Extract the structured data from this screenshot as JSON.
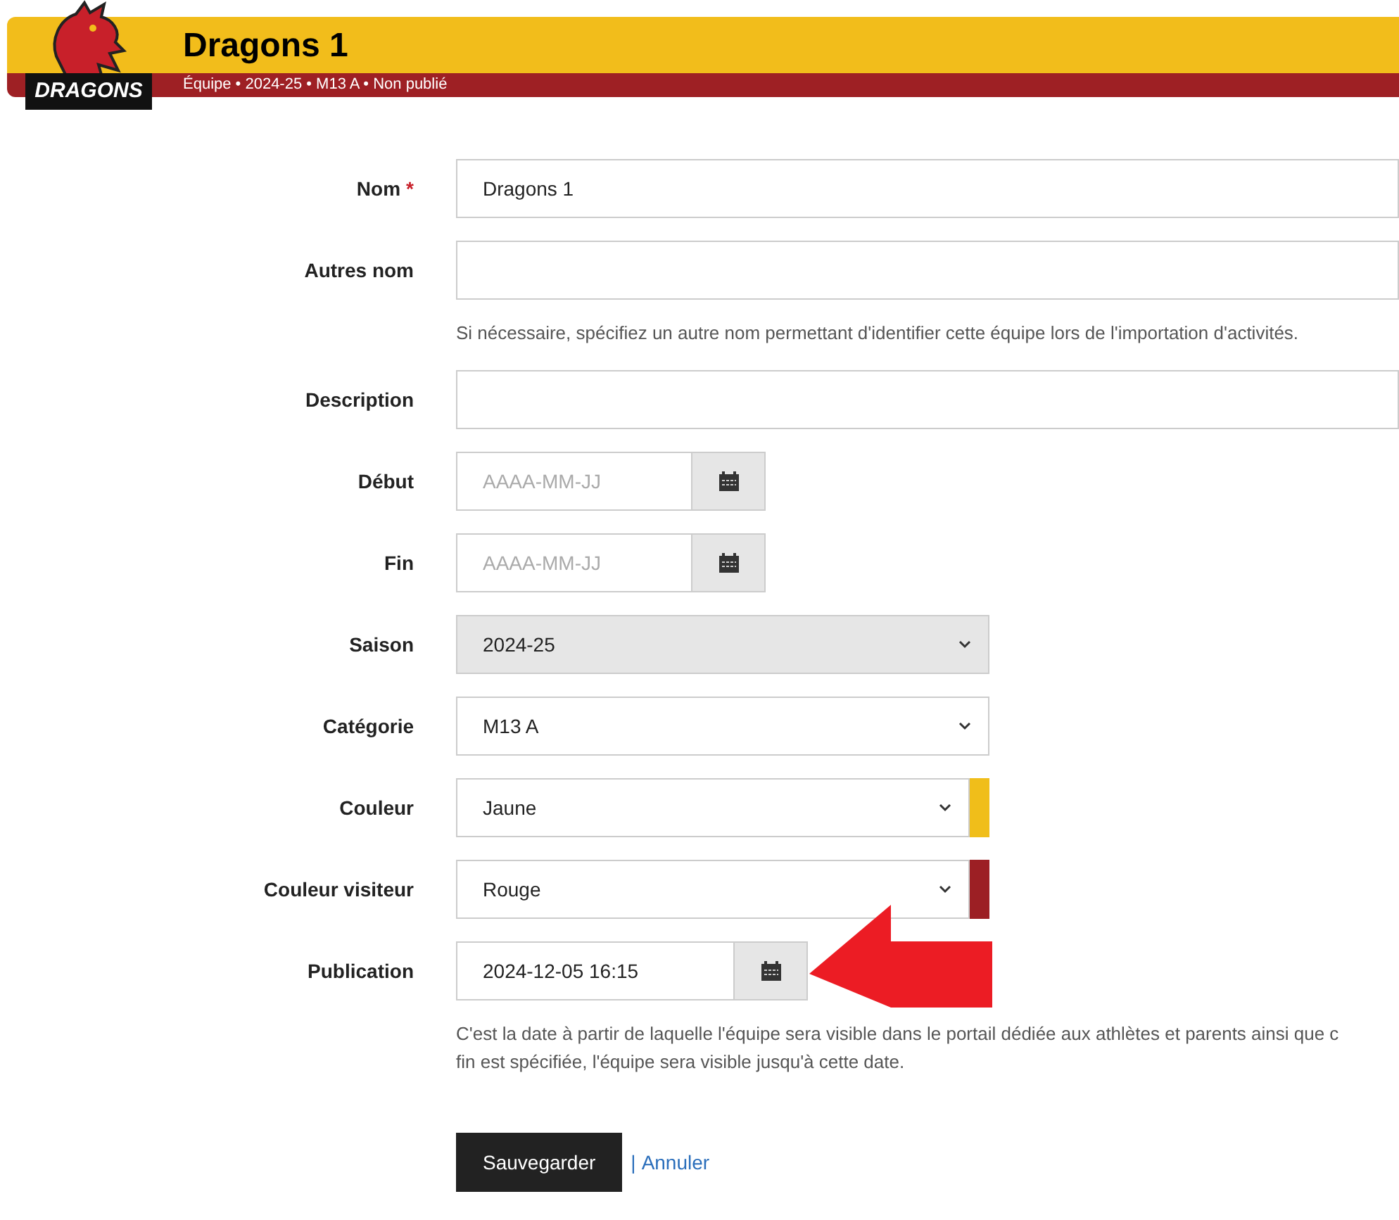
{
  "header": {
    "logo_text": "DRAGONS",
    "title": "Dragons 1",
    "subtitle": "Équipe • 2024-25 • M13 A • Non publié"
  },
  "fields": [
    {
      "kind": "text",
      "label": "Nom",
      "required_mark": "*",
      "value": "Dragons 1"
    },
    {
      "kind": "text",
      "label": "Autres nom",
      "help": [
        "Si nécessaire, spécifiez un autre nom permettant d'identifier cette équipe lors de l'importation d'activités."
      ]
    },
    {
      "kind": "text",
      "label": "Description"
    },
    {
      "kind": "date",
      "label": "Début",
      "placeholder": "AAAA-MM-JJ"
    },
    {
      "kind": "date",
      "label": "Fin",
      "placeholder": "AAAA-MM-JJ"
    },
    {
      "kind": "select",
      "label": "Saison",
      "value": "2024-25",
      "disabled": true
    },
    {
      "kind": "select",
      "label": "Catégorie",
      "value": "M13 A",
      "disabled": false
    },
    {
      "kind": "color",
      "label": "Couleur",
      "value": "Jaune",
      "color": "#f0be1a"
    },
    {
      "kind": "color",
      "label": "Couleur visiteur",
      "value": "Rouge",
      "color": "#9c1f24"
    },
    {
      "kind": "datetime",
      "label": "Publication",
      "value": "2024-12-05 16:15",
      "help": [
        "C'est la date à partir de laquelle l'équipe sera visible dans le portail dédiée aux athlètes et parents ainsi que c",
        "fin est spécifiée, l'équipe sera visible jusqu'à cette date."
      ]
    }
  ],
  "actions": {
    "save": "Sauvegarder",
    "separator": "|",
    "cancel": "Annuler"
  }
}
